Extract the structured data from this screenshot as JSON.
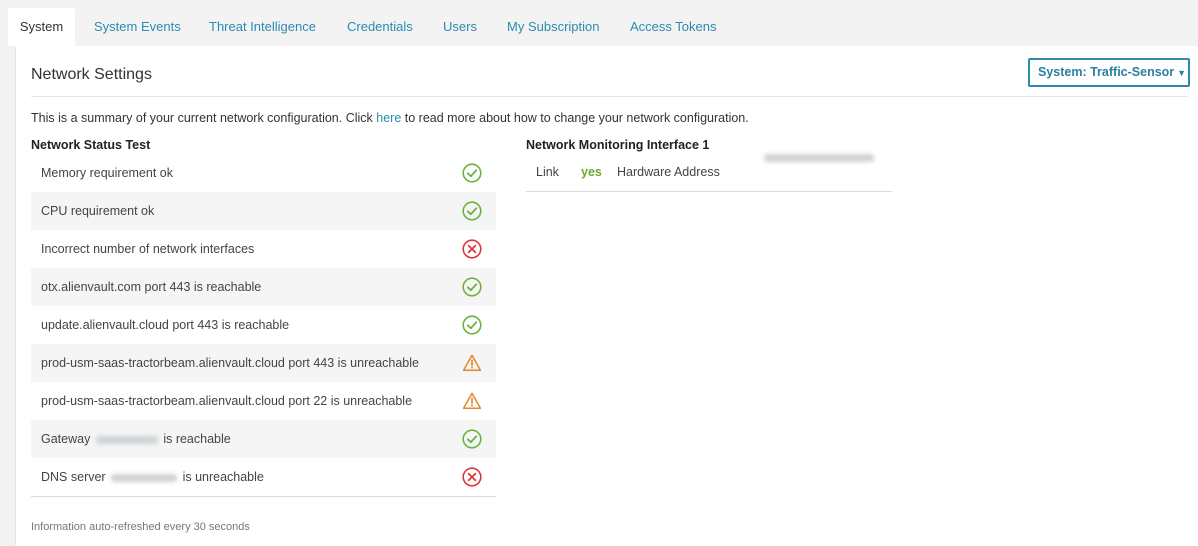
{
  "tabs": [
    {
      "label": "System",
      "active": true
    },
    {
      "label": "System Events"
    },
    {
      "label": "Threat Intelligence"
    },
    {
      "label": "Credentials"
    },
    {
      "label": "Users"
    },
    {
      "label": "My Subscription"
    },
    {
      "label": "Access Tokens"
    }
  ],
  "panel": {
    "title": "Network Settings",
    "system_select": {
      "value": "System: Traffic-Sensor",
      "icon": "caret-down-icon"
    },
    "summary": {
      "before": "This is a summary of your current network configuration. Click ",
      "link": "here",
      "after": " to read more about how to change your network configuration."
    }
  },
  "status_test": {
    "heading": "Network Status Test",
    "rows": [
      {
        "text": "Memory requirement ok",
        "status": "ok"
      },
      {
        "text": "CPU requirement ok",
        "status": "ok"
      },
      {
        "text": "Incorrect number of network interfaces",
        "status": "error"
      },
      {
        "text": "otx.alienvault.com port 443 is reachable",
        "status": "ok"
      },
      {
        "text": "update.alienvault.cloud port 443 is reachable",
        "status": "ok"
      },
      {
        "text": "prod-usm-saas-tractorbeam.alienvault.cloud port 443 is unreachable",
        "status": "warning"
      },
      {
        "text": "prod-usm-saas-tractorbeam.alienvault.cloud port 22 is unreachable",
        "status": "warning"
      },
      {
        "prefix": "Gateway",
        "suffix": "is reachable",
        "status": "ok",
        "redacted": true
      },
      {
        "prefix": "DNS server",
        "suffix": "is unreachable",
        "status": "error",
        "redacted": true
      }
    ]
  },
  "interface": {
    "heading": "Network Monitoring Interface 1",
    "link_label": "Link",
    "link_value": "yes",
    "hw_label": "Hardware Address"
  },
  "footer": {
    "note": "Information auto-refreshed every 30 seconds"
  },
  "colors": {
    "ok": "#6cb33f",
    "error": "#d9363e",
    "warning": "#e08a2c",
    "accent": "#2b8bb0"
  }
}
